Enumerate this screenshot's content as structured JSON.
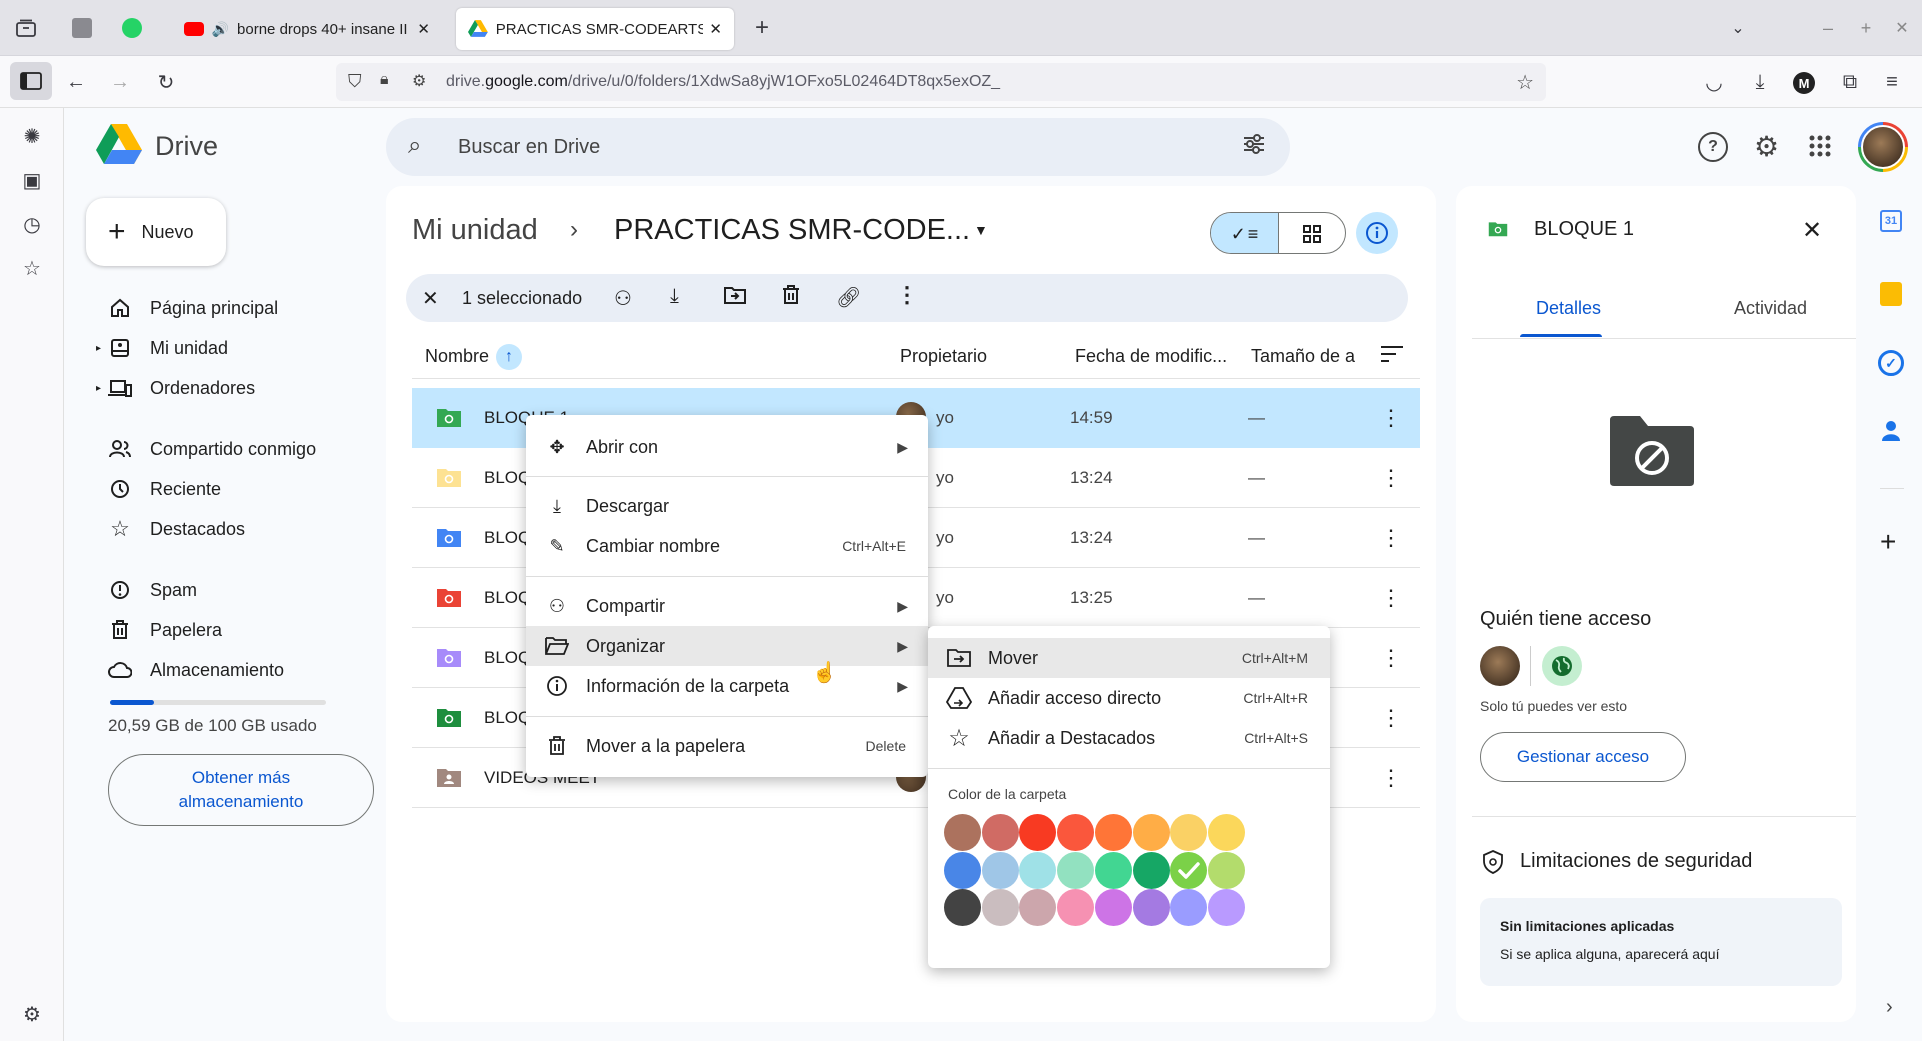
{
  "browser": {
    "tabs": [
      {
        "title": "borne drops 40+ insane II"
      },
      {
        "title": "PRACTICAS SMR-CODEARTS - ("
      }
    ],
    "url_prefix": "drive.",
    "url_domain": "google.com",
    "url_path": "/drive/u/0/folders/1XdwSa8yjW1OFxo5L02464DT8qx5exOZ_"
  },
  "drive": {
    "logo_text": "Drive",
    "search_placeholder": "Buscar en Drive",
    "new_button": "Nuevo",
    "nav": [
      {
        "label": "Página principal"
      },
      {
        "label": "Mi unidad"
      },
      {
        "label": "Ordenadores"
      },
      {
        "label": "Compartido conmigo"
      },
      {
        "label": "Reciente"
      },
      {
        "label": "Destacados"
      },
      {
        "label": "Spam"
      },
      {
        "label": "Papelera"
      },
      {
        "label": "Almacenamiento"
      }
    ],
    "storage_used_text": "20,59 GB de 100 GB usado",
    "storage_fraction": 0.206,
    "get_more_storage": "Obtener más almacenamiento"
  },
  "main": {
    "breadcrumb_root": "Mi unidad",
    "breadcrumb_current": "PRACTICAS SMR-CODE...",
    "selection_text": "1 seleccionado",
    "columns": {
      "name": "Nombre",
      "owner": "Propietario",
      "modified": "Fecha de modific...",
      "size": "Tamaño de a"
    },
    "rows": [
      {
        "name": "BLOQUE 1",
        "owner": "yo",
        "date": "14:59",
        "size": "—",
        "color": "#34a853"
      },
      {
        "name": "BLOQ",
        "owner": "yo",
        "date": "13:24",
        "size": "—",
        "color": "#fde293"
      },
      {
        "name": "BLOQ",
        "owner": "yo",
        "date": "13:24",
        "size": "—",
        "color": "#4285f4"
      },
      {
        "name": "BLOQ",
        "owner": "yo",
        "date": "13:25",
        "size": "—",
        "color": "#ea4335"
      },
      {
        "name": "BLOQ",
        "owner": "",
        "date": "",
        "size": "",
        "color": "#a78bfa"
      },
      {
        "name": "BLOQ",
        "owner": "",
        "date": "",
        "size": "",
        "color": "#1e8e3e"
      },
      {
        "name": "VIDEOS MEET",
        "owner": "",
        "date": "",
        "size": "",
        "color": "#a1887f"
      }
    ]
  },
  "context_menu": {
    "items": [
      {
        "label": "Abrir con",
        "shortcut": "",
        "submenu": true
      },
      {
        "label": "Descargar",
        "shortcut": "",
        "submenu": false
      },
      {
        "label": "Cambiar nombre",
        "shortcut": "Ctrl+Alt+E",
        "submenu": false
      },
      {
        "label": "Compartir",
        "shortcut": "",
        "submenu": true
      },
      {
        "label": "Organizar",
        "shortcut": "",
        "submenu": true
      },
      {
        "label": "Información de la carpeta",
        "shortcut": "",
        "submenu": true
      },
      {
        "label": "Mover a la papelera",
        "shortcut": "Delete",
        "submenu": false
      }
    ]
  },
  "submenu": {
    "items": [
      {
        "label": "Mover",
        "shortcut": "Ctrl+Alt+M"
      },
      {
        "label": "Añadir acceso directo",
        "shortcut": "Ctrl+Alt+R"
      },
      {
        "label": "Añadir a Destacados",
        "shortcut": "Ctrl+Alt+S"
      }
    ],
    "color_title": "Color de la carpeta",
    "colors": [
      "#ac725e",
      "#d06b64",
      "#f83a22",
      "#fa573c",
      "#ff7537",
      "#ffad46",
      "#fad165",
      "#fbd75b",
      "#4986e7",
      "#9fc6e7",
      "#9fe1e7",
      "#92e1c0",
      "#42d692",
      "#16a765",
      "#7bd148",
      "#b3dc6c",
      "#434343",
      "#cabdbf",
      "#cca6ac",
      "#f691b2",
      "#cd74e6",
      "#a47ae2",
      "#9a9cff",
      "#b99aff"
    ],
    "selected_color_index": 14
  },
  "details": {
    "title": "BLOQUE 1",
    "tab_details": "Detalles",
    "tab_activity": "Actividad",
    "access_title": "Quién tiene acceso",
    "access_note": "Solo tú puedes ver esto",
    "manage_access": "Gestionar acceso",
    "security_title": "Limitaciones de seguridad",
    "security_none": "Sin limitaciones aplicadas",
    "security_note": "Si se aplica alguna, aparecerá aquí"
  }
}
